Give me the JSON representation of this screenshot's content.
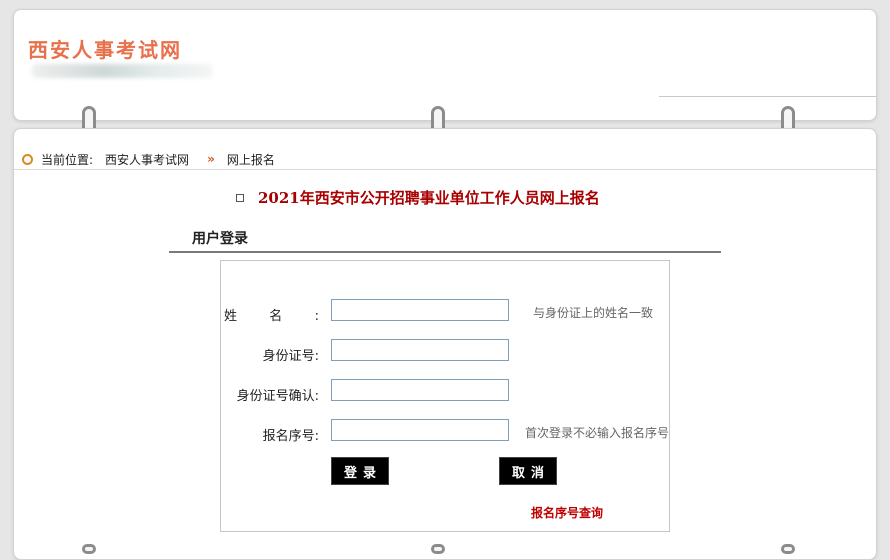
{
  "header": {
    "site_name": "西安人事考试网"
  },
  "breadcrumb": {
    "label": "当前位置:",
    "home": "西安人事考试网",
    "separator": "»",
    "current": "网上报名"
  },
  "page": {
    "title": "2021年西安市公开招聘事业单位工作人员网上报名",
    "section_title": "用户登录"
  },
  "form": {
    "name_label": "姓名:",
    "name_hint": "与身份证上的姓名一致",
    "id_label": "身份证号:",
    "id_confirm_label": "身份证号确认:",
    "reg_label": "报名序号:",
    "reg_hint": "首次登录不必输入报名序号",
    "name_value": "",
    "id_value": "",
    "id_confirm_value": "",
    "reg_value": ""
  },
  "buttons": {
    "login": "登录",
    "cancel": "取消"
  },
  "links": {
    "query": "报名序号查询"
  },
  "colors": {
    "title_red": "#a80000",
    "logo_orange": "#e8704a",
    "bullet_orange": "#d98a1e"
  }
}
